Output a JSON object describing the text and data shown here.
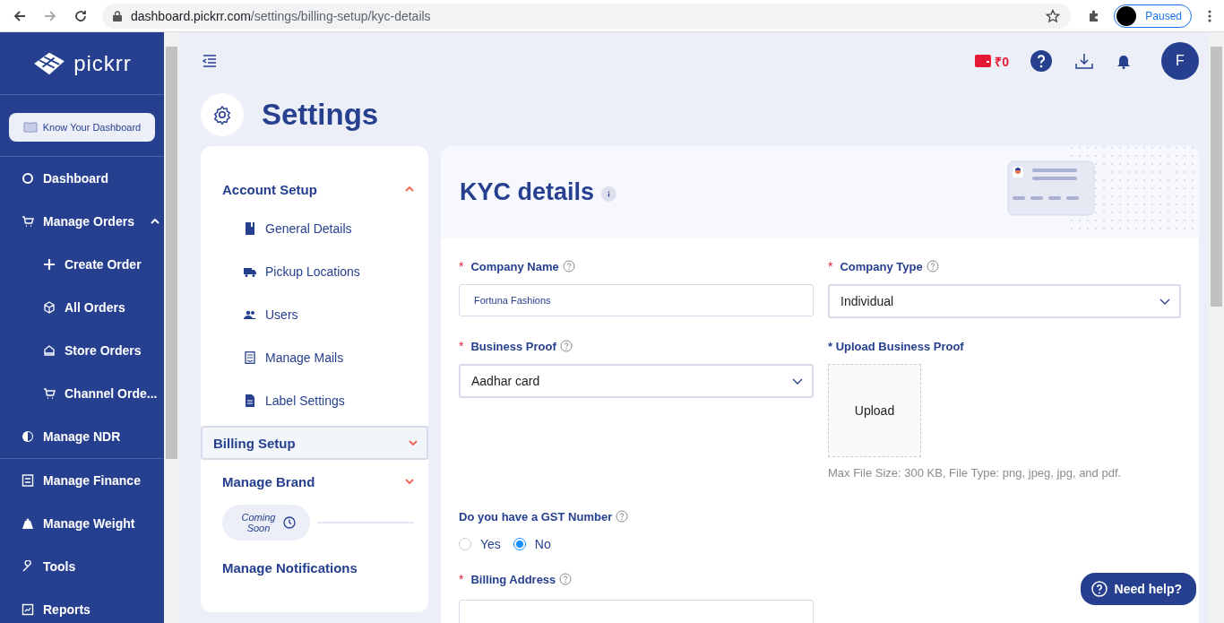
{
  "browser": {
    "url_host": "dashboard.pickrr.com",
    "url_path": "/settings/billing-setup/kyc-details",
    "profile_label": "Paused"
  },
  "sidebar": {
    "logo": "pickrr",
    "guide_button": "Know Your Dashboard",
    "items": [
      {
        "label": "Dashboard"
      },
      {
        "label": "Manage Orders",
        "expanded": true,
        "children": [
          {
            "label": "Create Order"
          },
          {
            "label": "All Orders"
          },
          {
            "label": "Store Orders"
          },
          {
            "label": "Channel Orde..."
          }
        ]
      },
      {
        "label": "Manage NDR"
      },
      {
        "label": "Manage Finance"
      },
      {
        "label": "Manage Weight"
      },
      {
        "label": "Tools"
      },
      {
        "label": "Reports"
      }
    ]
  },
  "header": {
    "wallet_balance": "₹0",
    "avatar_initial": "F"
  },
  "page_title": "Settings",
  "settings_menu": [
    {
      "title": "Account Setup",
      "expanded": true,
      "selected": false,
      "children": [
        {
          "label": "General Details"
        },
        {
          "label": "Pickup Locations"
        },
        {
          "label": "Users"
        },
        {
          "label": "Manage Mails"
        },
        {
          "label": "Label Settings"
        }
      ]
    },
    {
      "title": "Billing Setup",
      "expanded": false,
      "selected": true
    },
    {
      "title": "Manage Brand",
      "expanded": false,
      "selected": false,
      "badge": "Coming Soon"
    },
    {
      "title": "Manage Notifications",
      "selected": false
    }
  ],
  "kyc": {
    "title": "KYC details",
    "fields": [
      {
        "kind": "text",
        "label": "Company Name",
        "required_mark": "*",
        "value": "Fortuna Fashions"
      },
      {
        "kind": "select",
        "label": "Company Type",
        "required_mark": "*",
        "value": "Individual"
      },
      {
        "kind": "select",
        "label": "Business Proof",
        "required_mark": "*",
        "value": "Aadhar card"
      },
      {
        "kind": "upload",
        "label": "* Upload Business Proof",
        "button": "Upload",
        "hint": "Max File Size: 300 KB, File Type: png, jpeg, jpg, and pdf."
      },
      {
        "kind": "radio",
        "label": "Do you have a GST Number",
        "options": [
          {
            "label": "Yes",
            "selected": false
          },
          {
            "label": "No",
            "selected": true
          }
        ]
      },
      {
        "kind": "text",
        "label": "Billing Address",
        "required_mark": "*"
      }
    ]
  },
  "help_button": "Need help?"
}
